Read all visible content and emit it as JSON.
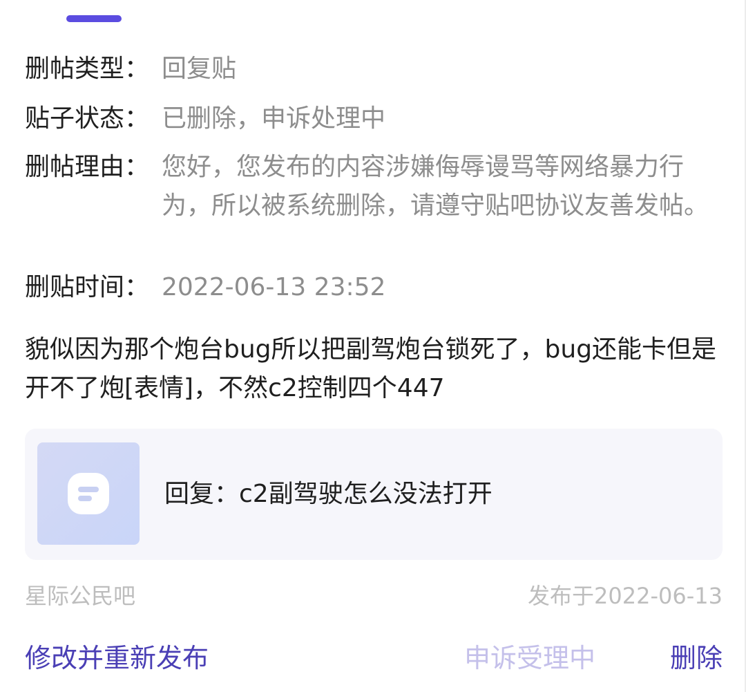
{
  "tab_indicator_color": "#5b4ce0",
  "info": {
    "type_label": "删帖类型：",
    "type_value": "回复贴",
    "status_label": "贴子状态：",
    "status_value": "已删除，申诉处理中",
    "reason_label": "删帖理由：",
    "reason_value": "您好，您发布的内容涉嫌侮辱谩骂等网络暴力行为，所以被系统删除，请遵守贴吧协议友善发帖。",
    "time_label": "删贴时间：",
    "time_value": "2022-06-13 23:52"
  },
  "post": {
    "content": "貌似因为那个炮台bug所以把副驾炮台锁死了，bug还能卡但是开不了炮[表情]，不然c2控制四个447"
  },
  "quote": {
    "icon": "post-placeholder-icon",
    "text": "回复：c2副驾驶怎么没法打开"
  },
  "meta": {
    "forum": "星际公民吧",
    "published": "发布于2022-06-13"
  },
  "actions": {
    "edit_label": "修改并重新发布",
    "appeal_label": "申诉受理中",
    "delete_label": "删除"
  },
  "colors": {
    "accent": "#4a3fb5",
    "disabled_accent": "#c4c0ea",
    "secondary_text": "#8d8d8d",
    "meta_text": "#bdbdbd"
  }
}
